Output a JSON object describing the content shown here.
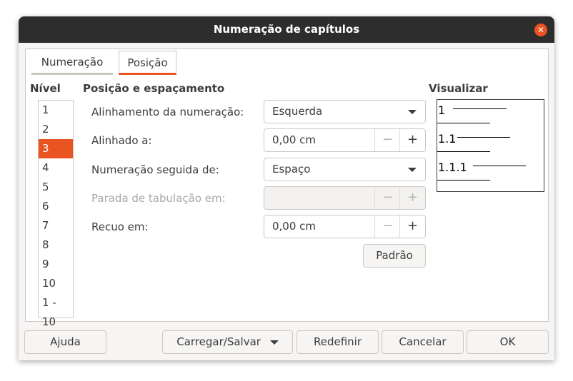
{
  "dialog": {
    "title": "Numeração de capítulos",
    "close_icon": "close-icon"
  },
  "tabs": [
    {
      "label": "Numeração",
      "active": false
    },
    {
      "label": "Posição",
      "active": true
    }
  ],
  "level": {
    "heading": "Nível",
    "items": [
      "1",
      "2",
      "3",
      "4",
      "5",
      "6",
      "7",
      "8",
      "9",
      "10",
      "1 - 10"
    ],
    "selected": "3"
  },
  "position": {
    "heading": "Posição e espaçamento",
    "alignment_label": "Alinhamento da numeração:",
    "alignment_value": "Esquerda",
    "aligned_at_label": "Alinhado a:",
    "aligned_at_value": "0,00 cm",
    "followed_by_label": "Numeração seguida de:",
    "followed_by_value": "Espaço",
    "tab_stop_label": "Parada de tabulação em:",
    "tab_stop_value": "",
    "indent_label": "Recuo em:",
    "indent_value": "0,00 cm",
    "minus": "−",
    "plus": "+",
    "default_button": "Padrão"
  },
  "preview": {
    "heading": "Visualizar",
    "lines": [
      "1",
      "1.1",
      "1.1.1"
    ]
  },
  "buttons": {
    "help": "Ajuda",
    "load_save": "Carregar/Salvar",
    "reset": "Redefinir",
    "cancel": "Cancelar",
    "ok": "OK"
  },
  "colors": {
    "accent": "#e95420",
    "titlebar": "#2d2d2d"
  }
}
